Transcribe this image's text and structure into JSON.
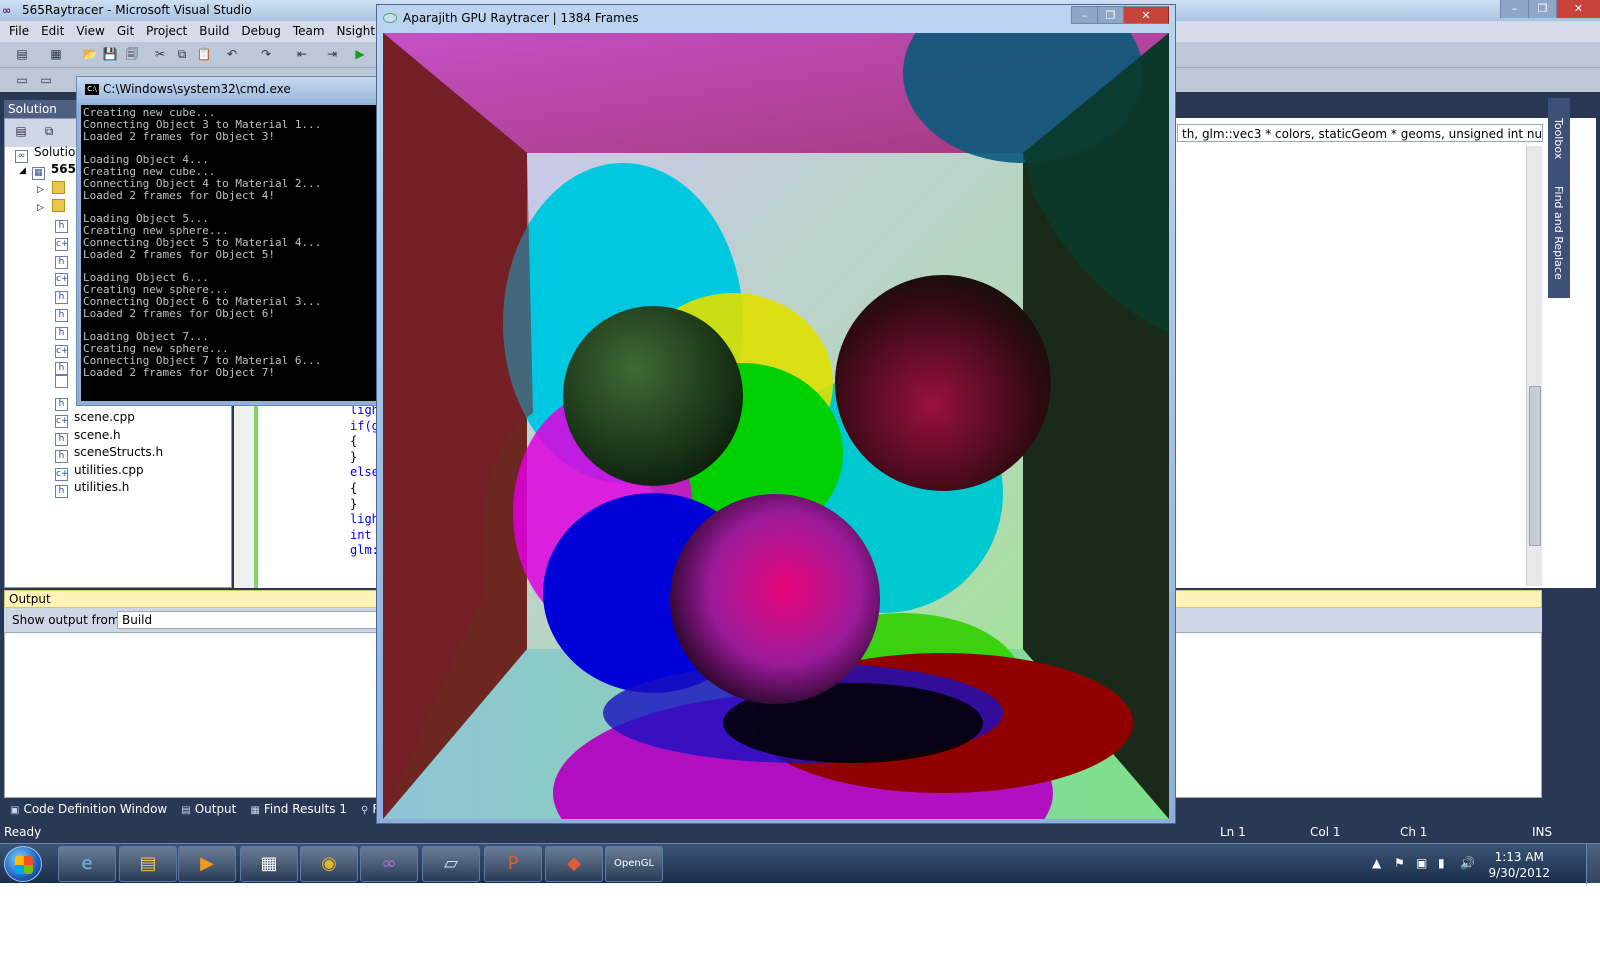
{
  "vs": {
    "title": "565Raytracer - Microsoft Visual Studio",
    "menu": [
      "File",
      "Edit",
      "View",
      "Git",
      "Project",
      "Build",
      "Debug",
      "Team",
      "Nsight",
      "D"
    ],
    "solution_explorer": {
      "title": "Solution Exp",
      "root": "Solutio",
      "project": "565",
      "files": [
        "scene.cpp",
        "scene.h",
        "sceneStructs.h",
        "utilities.cpp",
        "utilities.h"
      ]
    },
    "editor": {
      "signature": "th, glm::vec3 * colors, staticGeom * geoms, unsigned int numberOfC",
      "code": [
        "ligh",
        "if(g",
        "{",
        "}",
        "else",
        "{",
        "}",
        "ligh",
        "int",
        "glm:"
      ]
    },
    "output": {
      "title": "Output",
      "show_from_label": "Show output from:",
      "show_from_value": "Build"
    },
    "bottom_tabs": [
      "Code Definition Window",
      "Output",
      "Find Results 1",
      "Find S"
    ],
    "status": {
      "ready": "Ready",
      "ln": "Ln 1",
      "col": "Col 1",
      "ch": "Ch 1",
      "ins": "INS"
    },
    "side_rail": [
      "Toolbox",
      "Find and Replace"
    ]
  },
  "cmd": {
    "title": "C:\\Windows\\system32\\cmd.exe",
    "lines": [
      "Creating new cube...",
      "Connecting Object 3 to Material 1...",
      "Loaded 2 frames for Object 3!",
      "",
      "Loading Object 4...",
      "Creating new cube...",
      "Connecting Object 4 to Material 2...",
      "Loaded 2 frames for Object 4!",
      "",
      "Loading Object 5...",
      "Creating new sphere...",
      "Connecting Object 5 to Material 4...",
      "Loaded 2 frames for Object 5!",
      "",
      "Loading Object 6...",
      "Creating new sphere...",
      "Connecting Object 6 to Material 3...",
      "Loaded 2 frames for Object 6!",
      "",
      "Loading Object 7...",
      "Creating new sphere...",
      "Connecting Object 7 to Material 6...",
      "Loaded 2 frames for Object 7!"
    ]
  },
  "raytracer": {
    "title": "Aparajith GPU Raytracer | 1384 Frames"
  },
  "taskbar": {
    "time": "1:13 AM",
    "date": "9/30/2012"
  },
  "colors": {
    "vs_frame": "#293955",
    "accent_blue": "#1d5fbf"
  }
}
